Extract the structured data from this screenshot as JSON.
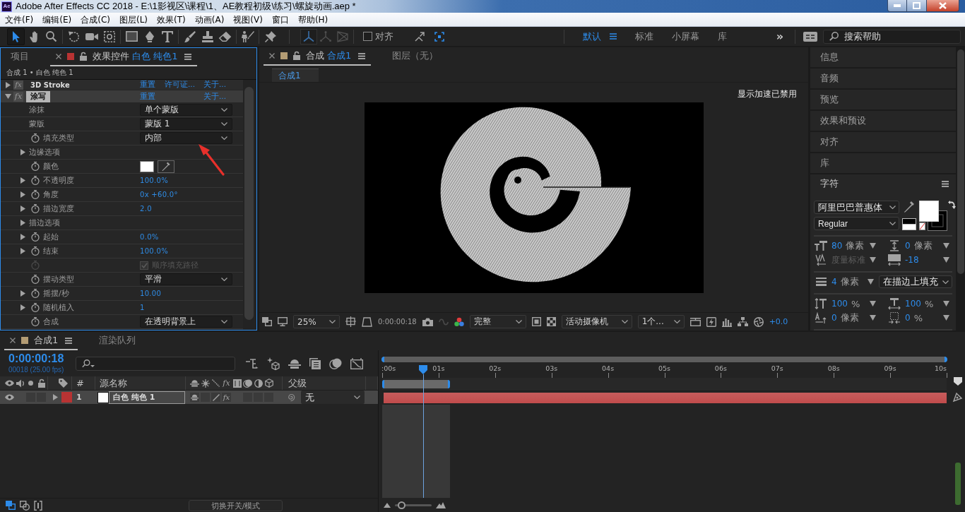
{
  "window": {
    "logo": "Ae",
    "title": "Adobe After Effects CC 2018 - E:\\1影视区\\课程\\1、AE教程初级\\练习\\螺旋动画.aep *"
  },
  "menu": [
    {
      "label": "文件(F)"
    },
    {
      "label": "编辑(E)"
    },
    {
      "label": "合成(C)"
    },
    {
      "label": "图层(L)"
    },
    {
      "label": "效果(T)"
    },
    {
      "label": "动画(A)"
    },
    {
      "label": "视图(V)"
    },
    {
      "label": "窗口"
    },
    {
      "label": "帮助(H)"
    }
  ],
  "toolbar": {
    "tools": [
      {
        "kind": "selection",
        "selected": true
      },
      {
        "kind": "hand",
        "selected": false
      },
      {
        "kind": "zoom",
        "selected": false
      },
      {
        "kind": "rotate",
        "selected": false
      },
      {
        "kind": "camera",
        "selected": false
      },
      {
        "kind": "pan-behind",
        "selected": false
      },
      {
        "kind": "rectangle",
        "selected": false
      },
      {
        "kind": "pen",
        "selected": false
      },
      {
        "kind": "type",
        "selected": false
      },
      {
        "kind": "brush",
        "selected": false
      },
      {
        "kind": "stamp",
        "selected": false
      },
      {
        "kind": "eraser",
        "selected": false
      },
      {
        "kind": "roto",
        "selected": false
      },
      {
        "kind": "pin",
        "selected": false
      }
    ],
    "axis_modes": [
      {
        "kind": "local",
        "selected": true
      },
      {
        "kind": "world",
        "selected": false
      },
      {
        "kind": "view",
        "selected": false
      }
    ],
    "snapping": {
      "label": "对齐",
      "checked": false
    },
    "workspaces": [
      {
        "label": "默认",
        "selected": true
      },
      {
        "label": "标准",
        "selected": false
      },
      {
        "label": "小屏幕",
        "selected": false
      },
      {
        "label": "库",
        "selected": false
      }
    ],
    "overflow": "»",
    "search": {
      "placeholder": "搜索帮助"
    }
  },
  "effect_panel": {
    "tabs": [
      {
        "kind": "panel",
        "label": "项目",
        "selected": false
      },
      {
        "kind": "viewer",
        "label": "效果控件",
        "target": "白色 纯色1",
        "color": "#b83333",
        "selected": true
      }
    ],
    "breadcrumb": "合成 1 • 白色 纯色 1",
    "effects": [
      {
        "name": "3D Stroke",
        "fx_label": "fx",
        "expanded": false,
        "selected": false,
        "links": [
          {
            "kind": "reset",
            "label": "重置"
          },
          {
            "kind": "license",
            "label": "许可证..."
          },
          {
            "kind": "about",
            "label": "关于..."
          }
        ]
      },
      {
        "name": "涂写",
        "fx_label": "fx",
        "expanded": true,
        "selected": true,
        "links": [
          {
            "kind": "reset",
            "label": "重置"
          },
          {
            "kind": "about",
            "label": "关于..."
          }
        ],
        "properties": [
          {
            "kind": "dropdown",
            "label": "涂抹",
            "value": "单个蒙版",
            "animatable": false,
            "disabled": false
          },
          {
            "kind": "dropdown",
            "label": "蒙版",
            "value": "蒙版 1",
            "animatable": false,
            "disabled": false
          },
          {
            "kind": "dropdown",
            "label": "填充类型",
            "value": "内部",
            "animatable": true,
            "disabled": false
          },
          {
            "kind": "group",
            "label": "边缘选项",
            "expanded": false,
            "animatable": false,
            "disabled": false
          },
          {
            "kind": "color",
            "label": "颜色",
            "color": "#ffffff",
            "animatable": true,
            "disabled": false
          },
          {
            "kind": "value",
            "label": "不透明度",
            "value": "100.0%",
            "expanded": false,
            "animatable": true,
            "disabled": false
          },
          {
            "kind": "value",
            "label": "角度",
            "value": "0x +60.0°",
            "expanded": false,
            "animatable": true,
            "disabled": false
          },
          {
            "kind": "value",
            "label": "描边宽度",
            "value": "2.0",
            "expanded": false,
            "animatable": true,
            "disabled": false
          },
          {
            "kind": "group",
            "label": "描边选项",
            "expanded": false,
            "animatable": false,
            "disabled": false
          },
          {
            "kind": "value",
            "label": "起始",
            "value": "0.0%",
            "expanded": false,
            "animatable": true,
            "disabled": false
          },
          {
            "kind": "value",
            "label": "结束",
            "value": "100.0%",
            "expanded": false,
            "animatable": true,
            "disabled": false
          },
          {
            "kind": "checkbox",
            "label": "顺序填充路径",
            "checked": true,
            "animatable": true,
            "disabled": true
          },
          {
            "kind": "dropdown",
            "label": "摆动类型",
            "value": "平滑",
            "animatable": true,
            "disabled": false
          },
          {
            "kind": "value",
            "label": "摇摆/秒",
            "value": "10.00",
            "expanded": false,
            "animatable": true,
            "disabled": false
          },
          {
            "kind": "value",
            "label": "随机植入",
            "value": "1",
            "expanded": false,
            "animatable": true,
            "disabled": false
          },
          {
            "kind": "dropdown",
            "label": "合成",
            "value": "在透明背景上",
            "animatable": true,
            "disabled": false
          }
        ]
      }
    ]
  },
  "viewer": {
    "tabs": [
      {
        "kind": "viewer",
        "label": "合成",
        "target": "合成1",
        "color": "#b39c74",
        "selected": true
      },
      {
        "kind": "panel",
        "label": "图层（无）",
        "selected": false
      }
    ],
    "breadcrumb": "合成1",
    "notice": "显示加速已禁用",
    "footer": {
      "zoom": "25%",
      "timecode": "0:00:00:18",
      "resolution": "完整",
      "camera": "活动摄像机",
      "views": "1个...",
      "exposure": "+0.0"
    }
  },
  "side_panels": [
    {
      "label": "信息"
    },
    {
      "label": "音频"
    },
    {
      "label": "预览"
    },
    {
      "label": "效果和预设"
    },
    {
      "label": "对齐"
    },
    {
      "label": "库"
    }
  ],
  "character": {
    "title": "字符",
    "font": "阿里巴巴普惠体",
    "style": "Regular",
    "metrics": [
      {
        "kind": "size",
        "value": "80",
        "unit": "像素",
        "disabled": false
      },
      {
        "kind": "leading",
        "value": "0",
        "unit": "像素",
        "disabled": false
      },
      {
        "kind": "kerning",
        "value": "度量标准",
        "disabled": true
      },
      {
        "kind": "tracking",
        "value": "-18",
        "disabled": false
      }
    ],
    "stroke": {
      "value": "4",
      "unit": "像素",
      "mode": "在描边上填充"
    },
    "scales": [
      {
        "kind": "vertical-scale",
        "value": "100",
        "unit": "%"
      },
      {
        "kind": "horizontal-scale",
        "value": "100",
        "unit": "%"
      },
      {
        "kind": "baseline",
        "value": "0",
        "unit": "像素"
      },
      {
        "kind": "tsume",
        "value": "0",
        "unit": "%"
      }
    ]
  },
  "timeline": {
    "tabs": [
      {
        "kind": "timeline",
        "label": "合成1",
        "color": "#b39c74",
        "selected": true
      },
      {
        "kind": "panel",
        "label": "渲染队列",
        "selected": false
      }
    ],
    "timecode": "0:00:00:18",
    "frame_info": "00018 (25.00 fps)",
    "columns": {
      "number": "#",
      "source": "源名称",
      "fx": "fx",
      "parent": "父级"
    },
    "layers": [
      {
        "number": "1",
        "name": "白色 纯色 1",
        "color": "#b83333",
        "visible": true,
        "solo": false,
        "locked": false,
        "expanded": false,
        "selected": true,
        "effects_on": true,
        "fx_label": "fx",
        "parent": "无"
      }
    ],
    "ruler": [
      ":00s",
      "01s",
      "02s",
      "03s",
      "04s",
      "05s",
      "06s",
      "07s",
      "08s",
      "09s",
      "10s"
    ],
    "playhead": {
      "level": 0.072
    },
    "work_area": {
      "level": 0.12
    },
    "mode_button": "切换开关/模式",
    "zoom": {
      "level": 0.18
    }
  },
  "annotations": [
    {
      "kind": "arrow"
    }
  ]
}
